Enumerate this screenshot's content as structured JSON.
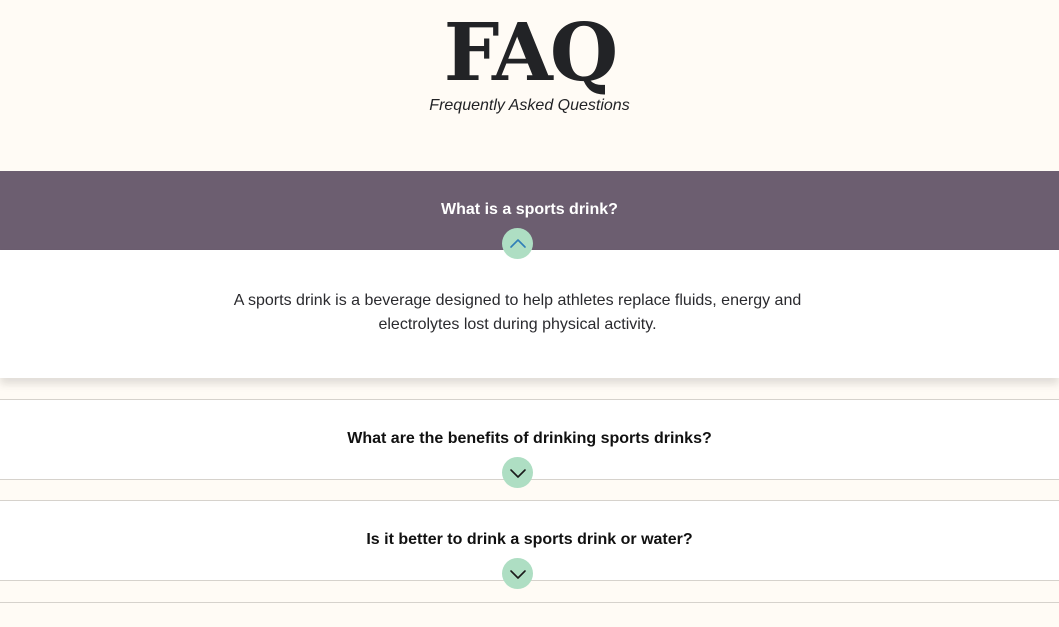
{
  "header": {
    "title": "FAQ",
    "subtitle": "Frequently Asked Questions"
  },
  "faq": {
    "items": [
      {
        "question": "What is a sports drink?",
        "answer": "A sports drink is a beverage designed to help athletes replace fluids, energy and electrolytes lost during physical activity.",
        "expanded": true,
        "toggle_icon": "chevron-up-icon"
      },
      {
        "question": "What are the benefits of drinking sports drinks?",
        "expanded": false,
        "toggle_icon": "chevron-down-icon"
      },
      {
        "question": "Is it better to drink a sports drink or water?",
        "expanded": false,
        "toggle_icon": "chevron-down-icon"
      }
    ]
  },
  "colors": {
    "page_background": "#fffbf5",
    "active_question_bg": "#6c5e70",
    "toggle_bg": "#aedec3",
    "toggle_icon_open": "#2f7fb8",
    "toggle_icon_closed": "#1b1b1b"
  }
}
